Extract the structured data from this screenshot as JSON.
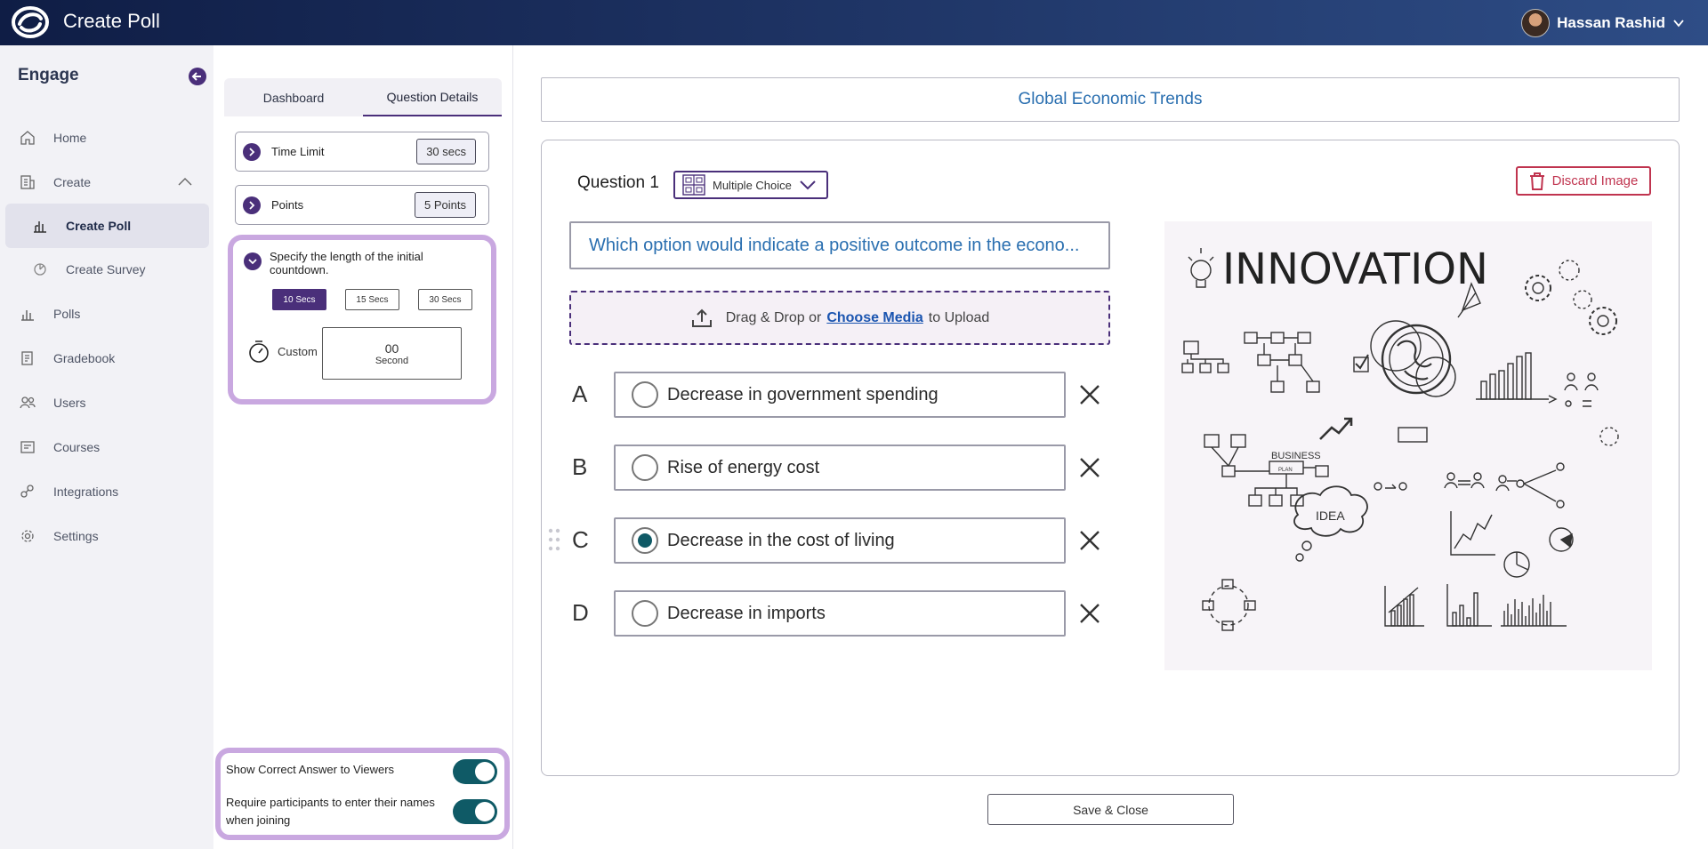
{
  "header": {
    "app_title": "Create Poll",
    "user_name": "Hassan Rashid"
  },
  "sidebar": {
    "brand": "Engage",
    "items": [
      {
        "label": "Home",
        "icon": "home-icon"
      },
      {
        "label": "Create",
        "icon": "create-icon"
      },
      {
        "label": "Create Poll",
        "icon": "poll-bar-icon"
      },
      {
        "label": "Create Survey",
        "icon": "survey-icon"
      },
      {
        "label": "Polls",
        "icon": "chart-icon"
      },
      {
        "label": "Gradebook",
        "icon": "gradebook-icon"
      },
      {
        "label": "Users",
        "icon": "users-icon"
      },
      {
        "label": "Courses",
        "icon": "courses-icon"
      },
      {
        "label": "Integrations",
        "icon": "integrations-icon"
      },
      {
        "label": "Settings",
        "icon": "gear-icon"
      }
    ]
  },
  "panel": {
    "tabs": [
      "Dashboard",
      "Question Details"
    ],
    "active_tab": "Question Details",
    "time_limit": {
      "label": "Time Limit",
      "value": "30 secs"
    },
    "points": {
      "label": "Points",
      "value": "5 Points"
    },
    "countdown": {
      "label": "Specify the length of the initial countdown.",
      "options": [
        "10 Secs",
        "15 Secs",
        "30 Secs"
      ],
      "selected": "10 Secs",
      "custom_label": "Custom",
      "custom_value": "00",
      "custom_unit": "Second"
    },
    "toggles": [
      {
        "label": "Show Correct Answer to Viewers",
        "on": true
      },
      {
        "label": "Require participants to enter their names when joining",
        "on": true
      }
    ]
  },
  "main": {
    "poll_title": "Global Economic Trends",
    "question_label": "Question 1",
    "question_type": "Multiple Choice",
    "discard_label": "Discard Image",
    "question_text": "Which option would indicate a positive outcome in the econo...",
    "upload": {
      "prefix": "Drag & Drop or",
      "link": "Choose Media",
      "suffix": "to Upload"
    },
    "options": [
      {
        "letter": "A",
        "text": "Decrease in government spending",
        "correct": false
      },
      {
        "letter": "B",
        "text": "Rise of energy cost",
        "correct": false
      },
      {
        "letter": "C",
        "text": "Decrease in the cost of living",
        "correct": true
      },
      {
        "letter": "D",
        "text": "Decrease in imports",
        "correct": false
      }
    ],
    "image": {
      "headline": "INNOVATION",
      "business_label": "BUSINESS",
      "plan_label": "PLAN",
      "idea_label": "IDEA"
    },
    "save_label": "Save & Close"
  },
  "colors": {
    "primary": "#4a2f7a",
    "teal": "#0f5a66",
    "link": "#2a6fb0",
    "danger": "#c0344f",
    "highlight": "#c9a8e0"
  }
}
